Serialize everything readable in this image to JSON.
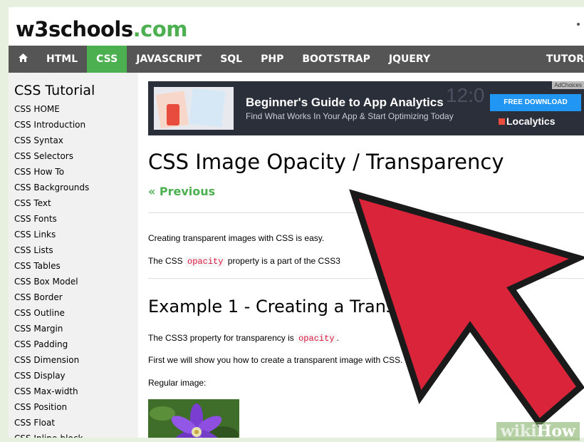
{
  "logo": {
    "part1": "w3schools",
    "part2": ".com"
  },
  "nav": {
    "items": [
      "HTML",
      "CSS",
      "JAVASCRIPT",
      "SQL",
      "PHP",
      "BOOTSTRAP",
      "JQUERY"
    ],
    "active": "CSS",
    "right_item": "TUTOR"
  },
  "sidebar": {
    "title": "CSS Tutorial",
    "items": [
      "CSS HOME",
      "CSS Introduction",
      "CSS Syntax",
      "CSS Selectors",
      "CSS How To",
      "CSS Backgrounds",
      "CSS Text",
      "CSS Fonts",
      "CSS Links",
      "CSS Lists",
      "CSS Tables",
      "CSS Box Model",
      "CSS Border",
      "CSS Outline",
      "CSS Margin",
      "CSS Padding",
      "CSS Dimension",
      "CSS Display",
      "CSS Max-width",
      "CSS Position",
      "CSS Float",
      "CSS Inline-block"
    ]
  },
  "ad": {
    "headline": "Beginner's Guide to App Analytics",
    "subline": "Find What Works In Your App & Start Optimizing Today",
    "clock": "12:0",
    "button": "FREE DOWNLOAD",
    "brand": "Localytics",
    "adchoices": "AdChoices"
  },
  "main": {
    "title": "CSS Image Opacity / Transparency",
    "prev": "« Previous",
    "para1": "Creating transparent images with CSS is easy.",
    "para2_before": "The CSS",
    "para2_code": "opacity",
    "para2_after": "property is a part of the CSS3",
    "example_heading": "Example 1 - Creating a Transparent Image",
    "para3_before": "The CSS3 property for transparency is",
    "para3_code": "opacity",
    "para3_after": ".",
    "para4": "First we will show you how to create a transparent image with CSS.",
    "para5": "Regular image:"
  },
  "colors": {
    "brand_green": "#4CAF50",
    "nav_bg": "#555555",
    "arrow_red": "#d9243a",
    "code_red": "#dc143c"
  },
  "watermark": {
    "part1": "wiki",
    "part2": "How"
  }
}
